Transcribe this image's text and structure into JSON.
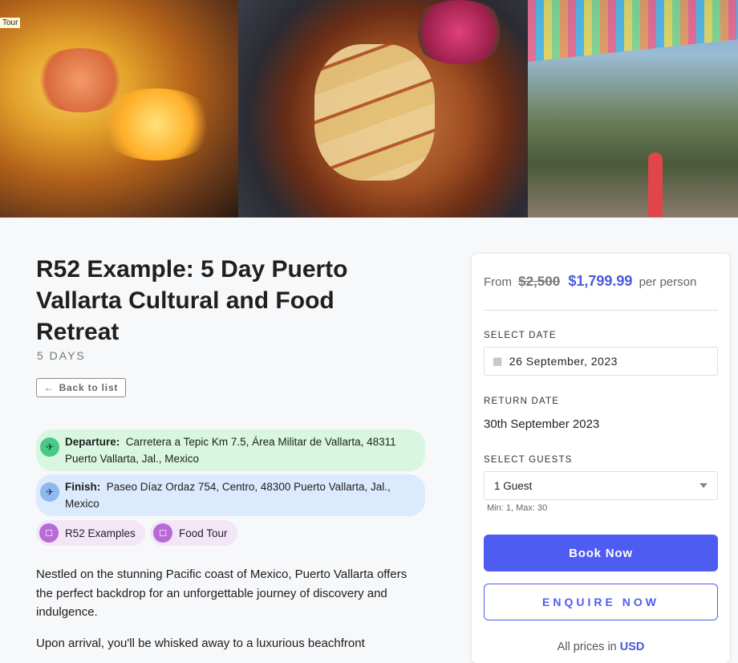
{
  "gallery": {
    "badge": "Tour",
    "images": [
      "food-fajitas-image",
      "tacos-image",
      "street-papel-picado-image"
    ]
  },
  "tour": {
    "title": "R52 Example: 5 Day Puerto Vallarta Cultural and Food Retreat",
    "duration": "5 DAYS",
    "back_label": "Back to list",
    "departure_label": "Departure:",
    "departure_value": "Carretera a Tepic Km 7.5, Área Militar de Vallarta, 48311 Puerto Vallarta, Jal., Mexico",
    "finish_label": "Finish:",
    "finish_value": "Paseo Díaz Ordaz 754, Centro, 48300 Puerto Vallarta, Jal., Mexico",
    "tags": [
      "R52 Examples",
      "Food Tour"
    ],
    "paragraphs": [
      "Nestled on the stunning Pacific coast of Mexico, Puerto Vallarta offers the perfect backdrop for an unforgettable journey of discovery and indulgence.",
      "Upon arrival, you'll be whisked away to a luxurious beachfront"
    ]
  },
  "booking": {
    "from_label": "From",
    "old_price": "$2,500",
    "new_price": "$1,799.99",
    "per_label": "per person",
    "select_date_label": "SELECT DATE",
    "select_date_value": "26 September, 2023",
    "return_date_label": "RETURN DATE",
    "return_date_value": "30th September 2023",
    "select_guests_label": "SELECT GUESTS",
    "guests_value": "1 Guest",
    "guests_minmax": "Min: 1, Max: 30",
    "book_label": "Book Now",
    "enquire_label": "ENQUIRE NOW",
    "currency_prefix": "All prices in",
    "currency": "USD"
  },
  "colors": {
    "accent": "#4f5cf2",
    "price": "#4a5ad8",
    "departure_bg": "#d9f7e0",
    "finish_bg": "#dbeafc",
    "tag_bg": "#f3e7f7"
  }
}
